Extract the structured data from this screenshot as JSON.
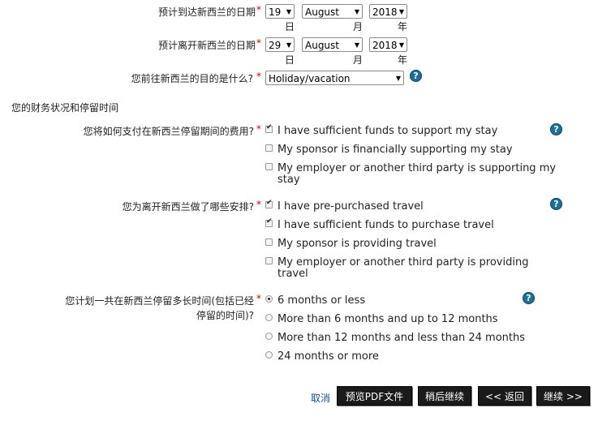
{
  "arrival": {
    "label": "预计到达新西兰的日期",
    "required_mark": "*",
    "day": "19",
    "month": "August",
    "year": "2018",
    "day_unit": "日",
    "month_unit": "月",
    "year_unit": "年"
  },
  "departure": {
    "label": "预计离开新西兰的日期",
    "required_mark": "*",
    "day": "29",
    "month": "August",
    "year": "2018",
    "day_unit": "日",
    "month_unit": "月",
    "year_unit": "年"
  },
  "purpose": {
    "label": "您前往新西兰的目的是什么?",
    "required_mark": "*",
    "value": "Holiday/vacation",
    "help": "?"
  },
  "section_title": "您的财务状况和停留时间",
  "funds": {
    "label": "您将如何支付在新西兰停留期间的费用?",
    "required_mark": "*",
    "help": "?",
    "options": [
      {
        "text": "I have sufficient funds to support my stay",
        "checked": true
      },
      {
        "text": "My sponsor is financially supporting my stay",
        "checked": false
      },
      {
        "text_line1": "My employer or another third party is supporting my",
        "text_line2": "stay",
        "checked": false
      }
    ]
  },
  "onward": {
    "label": "您为离开新西兰做了哪些安排?",
    "required_mark": "*",
    "help": "?",
    "options": [
      {
        "text": "I have pre-purchased travel",
        "checked": true
      },
      {
        "text": "I have sufficient funds to purchase travel",
        "checked": true
      },
      {
        "text": "My sponsor is providing travel",
        "checked": false
      },
      {
        "text_line1": "My employer or another third party is providing",
        "text_line2": "travel",
        "checked": false
      }
    ]
  },
  "length": {
    "label_line1": "您计划一共在新西兰停留多长时间(包括已经",
    "label_line2": "停留的时间)?",
    "required_mark": "*",
    "help": "?",
    "options": [
      {
        "text": "6 months or less",
        "selected": true
      },
      {
        "text": "More than 6 months and up to 12 months",
        "selected": false
      },
      {
        "text": "More than 12 months and less than 24 months",
        "selected": false
      },
      {
        "text": "24 months or more",
        "selected": false
      }
    ]
  },
  "footer": {
    "cancel": "取消",
    "preview_pdf": "预览PDF文件",
    "save_later": "稍后继续",
    "back": "<< 返回",
    "continue": "继续 >>"
  }
}
